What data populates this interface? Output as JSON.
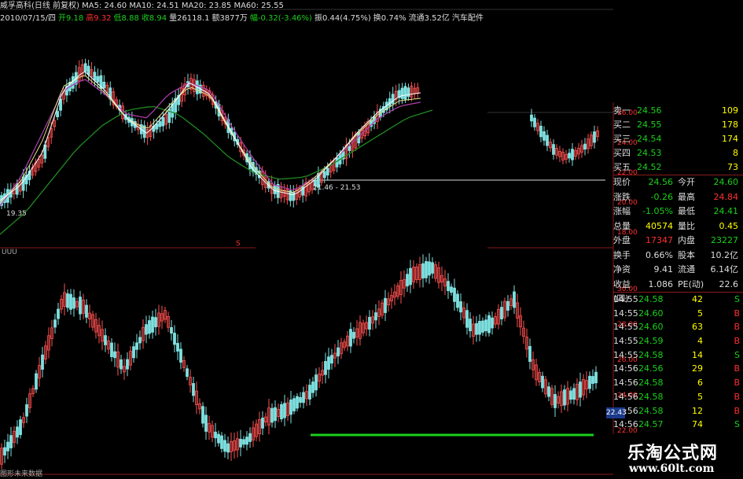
{
  "header": {
    "line1": "威孚高科(日线 前复权) MA5: 24.60 MA10: 24.51 MA20: 23.85 MA60: 25.55",
    "line2_date": "2010/07/15/四",
    "line2_open": "开9.18",
    "line2_high": "高9.32",
    "line2_low": "低8.88",
    "line2_close": "收8.94",
    "line2_vol": "量26118.1",
    "line2_amt": "额3877万",
    "line2_chg": "幅-0.32(-3.46%)",
    "line2_amp": "振0.44(4.75%)",
    "line2_turn": "换0.74%",
    "line2_float": "流通3.52亿",
    "line2_sector": "汽车配件"
  },
  "annotations": {
    "low_label": "19.35",
    "range_label": "21.46 - 21.53",
    "marker_s": "S",
    "uuu": "UUU"
  },
  "axis_upper": [
    "26.00",
    "24.00",
    "22.00",
    "20.00",
    "18.00"
  ],
  "axis_lower": [
    "30.00",
    "28.00",
    "26.00",
    "24.00",
    "22.00"
  ],
  "orderbook": [
    {
      "label": "卖一",
      "price": "24.56",
      "vol": "109"
    },
    {
      "label": "买二",
      "price": "24.55",
      "vol": "178"
    },
    {
      "label": "买三",
      "price": "24.54",
      "vol": "174"
    },
    {
      "label": "买四",
      "price": "24.53",
      "vol": "8"
    },
    {
      "label": "买五",
      "price": "24.52",
      "vol": "73"
    }
  ],
  "stats": [
    {
      "l": "现价",
      "v": "24.56",
      "vc": "#1ad01a",
      "l2": "今开",
      "v2": "24.60",
      "v2c": "#1ad01a"
    },
    {
      "l": "涨跌",
      "v": "-0.26",
      "vc": "#1ad01a",
      "l2": "最高",
      "v2": "24.84",
      "v2c": "#ff3030"
    },
    {
      "l": "涨幅",
      "v": "-1.05%",
      "vc": "#1ad01a",
      "l2": "最低",
      "v2": "24.41",
      "v2c": "#1ad01a"
    },
    {
      "l": "总量",
      "v": "40574",
      "vc": "#ffff00",
      "l2": "量比",
      "v2": "0.45",
      "v2c": "#ffff00"
    },
    {
      "l": "外盘",
      "v": "17347",
      "vc": "#ff3030",
      "l2": "内盘",
      "v2": "23227",
      "v2c": "#1ad01a"
    },
    {
      "l": "换手",
      "v": "0.66%",
      "vc": "#ddd",
      "l2": "股本",
      "v2": "10.2亿",
      "v2c": "#ddd"
    },
    {
      "l": "净资",
      "v": "9.41",
      "vc": "#ddd",
      "l2": "流通",
      "v2": "6.14亿",
      "v2c": "#ddd"
    },
    {
      "l": "收益(四)",
      "v": "1.086",
      "vc": "#ddd",
      "l2": "PE(动)",
      "v2": "22.6",
      "v2c": "#ddd"
    }
  ],
  "ticks": [
    {
      "t": "14:55",
      "p": "24.58",
      "vol": "42",
      "s": "S",
      "sc": "#1ad01a"
    },
    {
      "t": "14:55",
      "p": "24.60",
      "vol": "5",
      "s": "B",
      "sc": "#ff3030"
    },
    {
      "t": "14:55",
      "p": "24.60",
      "vol": "63",
      "s": "B",
      "sc": "#ff3030"
    },
    {
      "t": "14:55",
      "p": "24.59",
      "vol": "4",
      "s": "B",
      "sc": "#ff3030"
    },
    {
      "t": "14:55",
      "p": "24.58",
      "vol": "14",
      "s": "S",
      "sc": "#1ad01a"
    },
    {
      "t": "14:56",
      "p": "24.56",
      "vol": "29",
      "s": "B",
      "sc": "#ff3030"
    },
    {
      "t": "14:56",
      "p": "24.58",
      "vol": "6",
      "s": "B",
      "sc": "#ff3030"
    },
    {
      "t": "14:56",
      "p": "24.58",
      "vol": "5",
      "s": "B",
      "sc": "#ff3030"
    },
    {
      "t": "14:56",
      "p": "24.58",
      "vol": "12",
      "s": "B",
      "sc": "#ff3030"
    },
    {
      "t": "14:56",
      "p": "24.57",
      "vol": "74",
      "s": "S",
      "sc": "#1ad01a"
    }
  ],
  "price_tag": "22.43",
  "footer": "图形未来数据",
  "watermark": {
    "cn": "乐淘公式网",
    "url": "www.60lt.com"
  }
}
